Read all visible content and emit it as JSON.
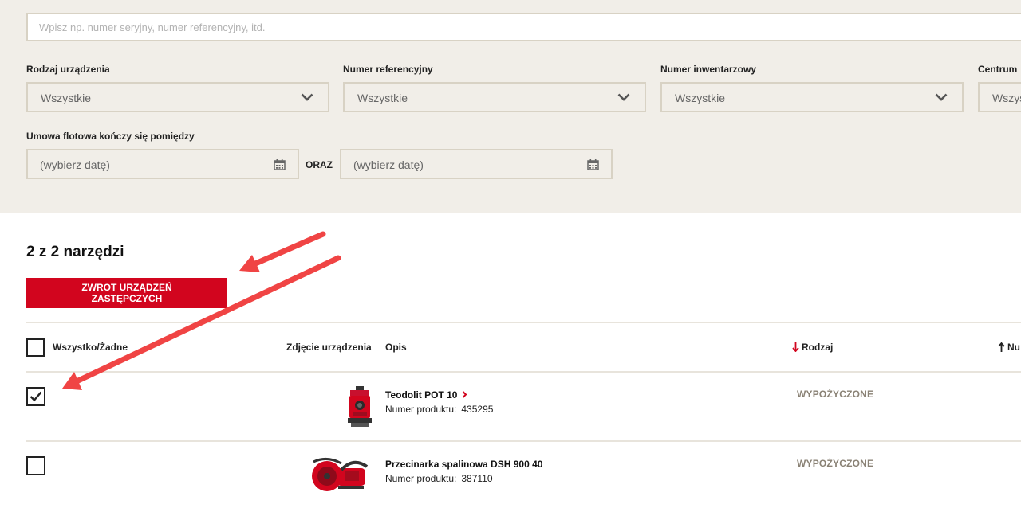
{
  "search": {
    "placeholder": "Wpisz np. numer seryjny, numer referencyjny, itd."
  },
  "filters": {
    "device_type": {
      "label": "Rodzaj urządzenia",
      "value": "Wszystkie"
    },
    "reference_number": {
      "label": "Numer referencyjny",
      "value": "Wszystkie"
    },
    "inventory_number": {
      "label": "Numer inwentarzowy",
      "value": "Wszystkie"
    },
    "center": {
      "label": "Centrum",
      "value": "Wszys"
    },
    "fleet_contract": {
      "label": "Umowa flotowa kończy się pomiędzy",
      "from_placeholder": "(wybierz datę)",
      "and_label": "ORAZ",
      "to_placeholder": "(wybierz datę)"
    }
  },
  "results": {
    "count_text": "2 z 2 narzędzi",
    "return_button": {
      "line1": "ZWROT URZĄDZEŃ",
      "line2": "ZASTĘPCZYCH"
    }
  },
  "table": {
    "headers": {
      "select_all": "Wszystko/Żadne",
      "photo": "Zdjęcie urządzenia",
      "description": "Opis",
      "type": "Rodzaj",
      "number": "Nu"
    },
    "rows": [
      {
        "name": "Teodolit POT 10",
        "product_label": "Numer produktu:",
        "product_number": "435295",
        "status": "WYPOŻYCZONE",
        "checked": true
      },
      {
        "name": "Przecinarka spalinowa DSH 900 40",
        "product_label": "Numer produktu:",
        "product_number": "387110",
        "status": "WYPOŻYCZONE",
        "checked": false
      }
    ]
  },
  "colors": {
    "accent": "#d2051e",
    "panel": "#f1eee8",
    "border": "#d8d2c4",
    "annotation": "#f04444"
  }
}
